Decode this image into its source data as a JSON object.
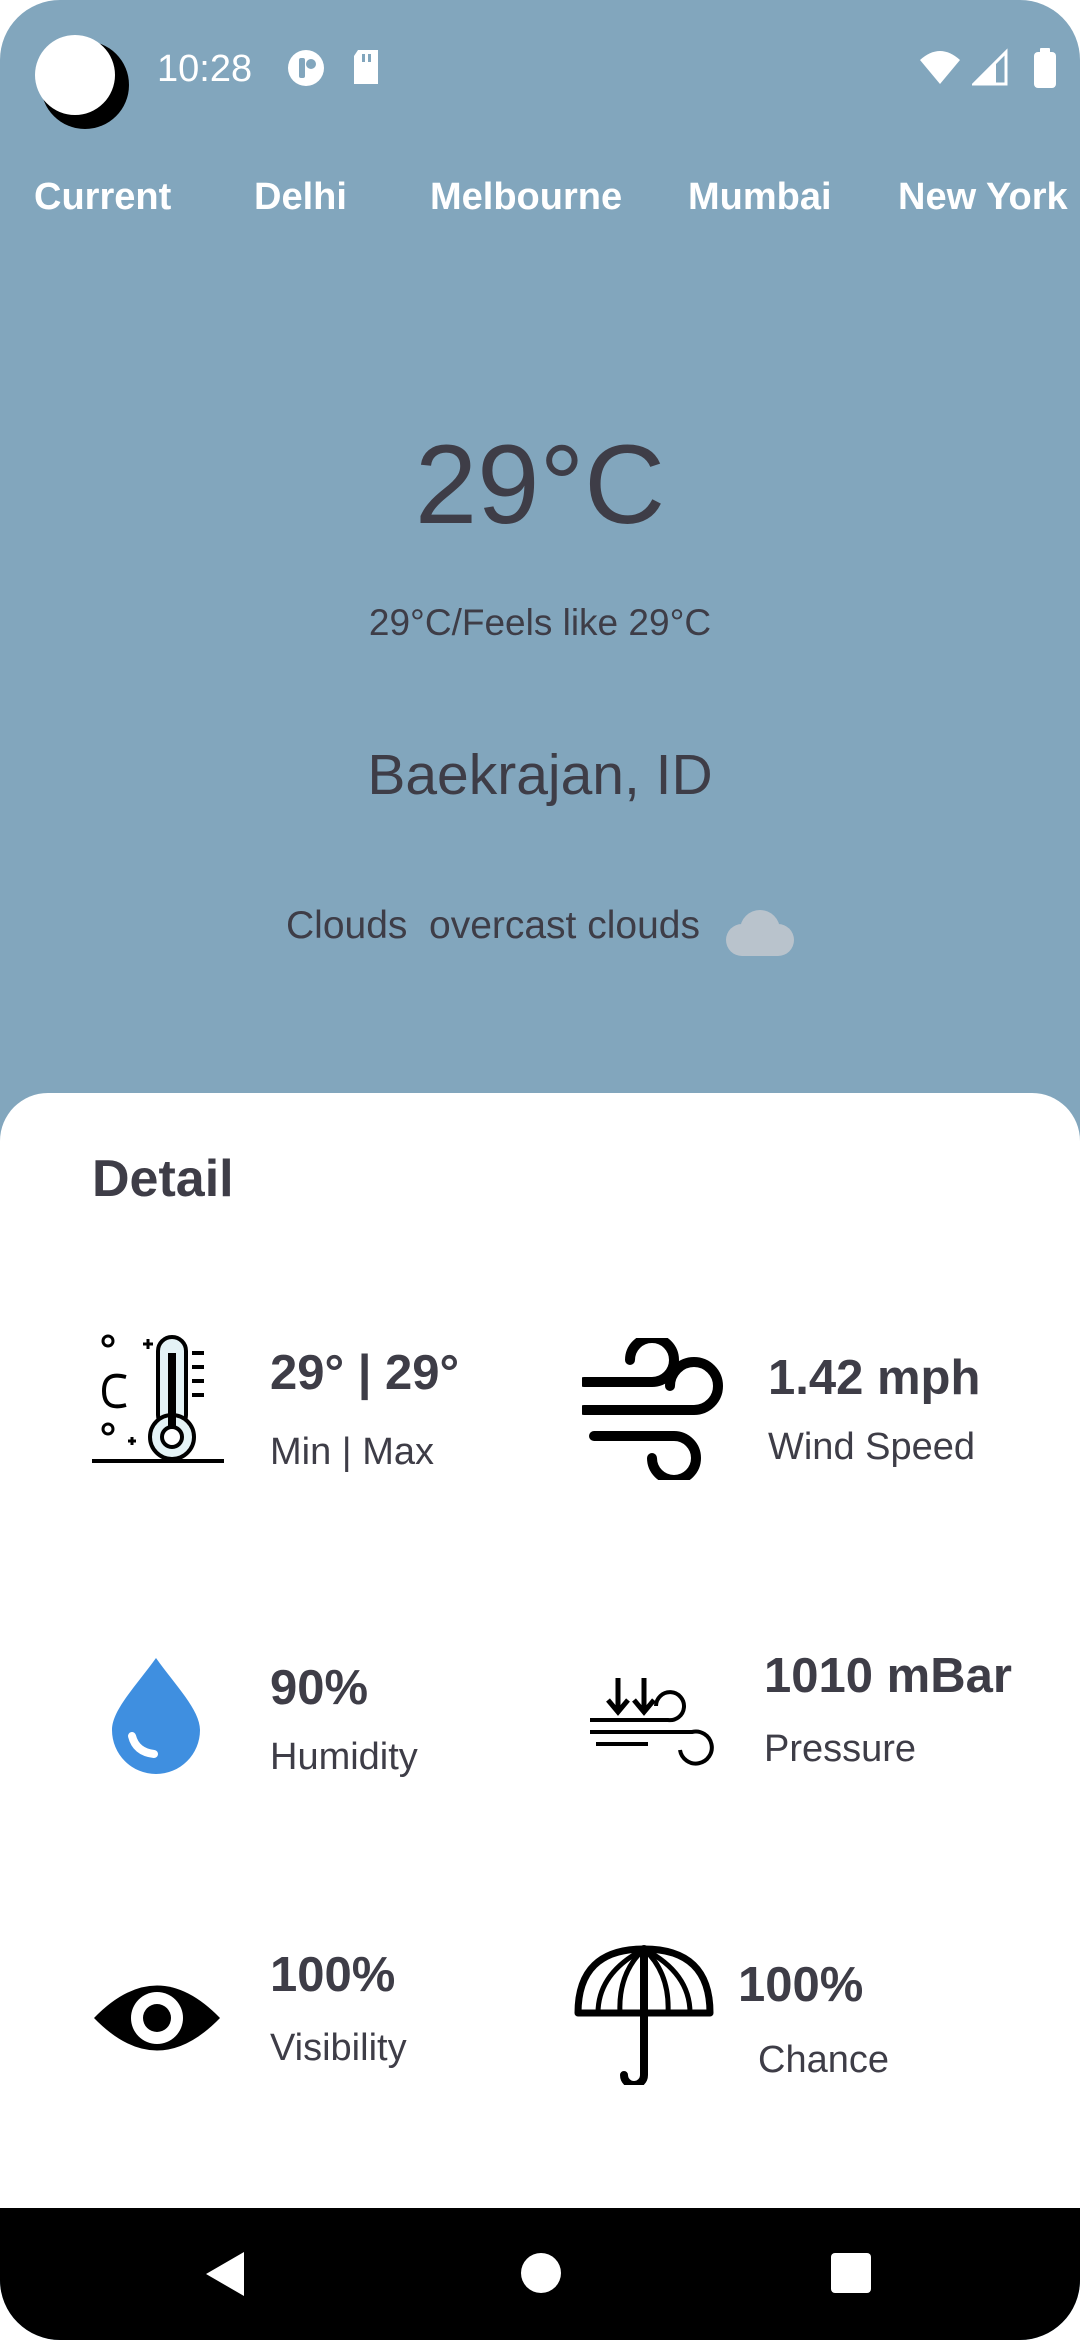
{
  "status_bar": {
    "time": "10:28",
    "icons": [
      "app-logo-icon",
      "notification-icon",
      "sd-card-icon",
      "wifi-icon",
      "signal-icon",
      "battery-icon"
    ]
  },
  "tabs": [
    "Current",
    "Delhi",
    "Melbourne",
    "Mumbai",
    "New York"
  ],
  "current": {
    "temperature": "29°C",
    "feels_like": "29°C/Feels like 29°C",
    "location": "Baekrajan, ID",
    "condition": "Clouds",
    "description": "overcast clouds",
    "condition_icon": "cloud-icon"
  },
  "detail": {
    "title": "Detail",
    "items": [
      {
        "value": "29° | 29°",
        "label": "Min | Max",
        "icon": "thermometer-icon"
      },
      {
        "value": "1.42 mph",
        "label": "Wind Speed",
        "icon": "wind-icon"
      },
      {
        "value": "90%",
        "label": "Humidity",
        "icon": "water-drop-icon"
      },
      {
        "value": "1010 mBar",
        "label": "Pressure",
        "icon": "pressure-icon"
      },
      {
        "value": "100%",
        "label": "Visibility",
        "icon": "eye-icon"
      },
      {
        "value": "100%",
        "label": "Chance",
        "icon": "umbrella-icon"
      }
    ]
  },
  "colors": {
    "sky_background": "#82a6bd",
    "text": "#3e3d47",
    "sheet": "#ffffff",
    "humidity_drop": "#3f8fe0"
  }
}
